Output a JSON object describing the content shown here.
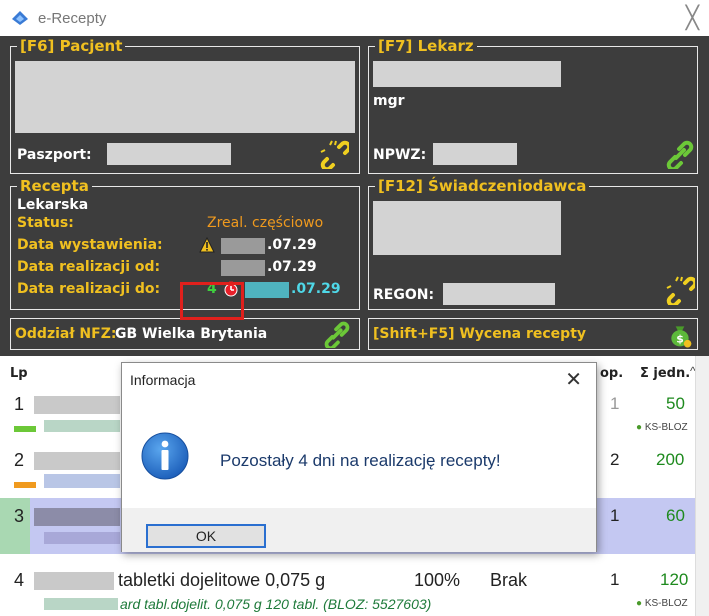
{
  "window": {
    "title": "e-Recepty",
    "close": "╳"
  },
  "patient": {
    "legend": "[F6] Pacjent",
    "passport_label": "Paszport:"
  },
  "doctor": {
    "legend": "[F7] Lekarz",
    "title_prefix": "mgr",
    "npwz_label": "NPWZ:"
  },
  "prescription": {
    "legend": "Recepta",
    "type": "Lekarska",
    "status_label": "Status:",
    "status_value": "Zreal. częściowo",
    "issued_label": "Data wystawienia:",
    "issued_value": ".07.29",
    "from_label": "Data realizacji od:",
    "from_value": ".07.29",
    "to_label": "Data realizacji do:",
    "days_left": "4",
    "to_value": ".07.29"
  },
  "provider": {
    "legend": "[F12] Świadczeniodawca",
    "regon_label": "REGON:"
  },
  "nfz": {
    "label": "Oddział NFZ:",
    "value": "GB Wielka Brytania"
  },
  "pricing": {
    "label": "[Shift+F5] Wycena recepty"
  },
  "table": {
    "headers": {
      "lp": "Lp",
      "op": "op.",
      "units": "Σ jedn."
    },
    "rows": [
      {
        "lp": "1",
        "op": "1",
        "units": "50",
        "tag": "KS-BLOZ"
      },
      {
        "lp": "2",
        "op": "2",
        "units": "200"
      },
      {
        "lp": "3",
        "op": "1",
        "units": "60"
      },
      {
        "lp": "4",
        "desc": "tabletki dojelitowe 0,075 g",
        "percent": "100%",
        "status": "Brak",
        "op": "1",
        "units": "120",
        "sub": "ard tabl.dojelit. 0,075 g 120 tabl. (BLOZ: 5527603)",
        "tag": "KS-BLOZ"
      }
    ]
  },
  "dialog": {
    "title": "Informacja",
    "close": "✕",
    "message": "Pozostały 4 dni na realizację recepty!",
    "ok": "OK"
  }
}
